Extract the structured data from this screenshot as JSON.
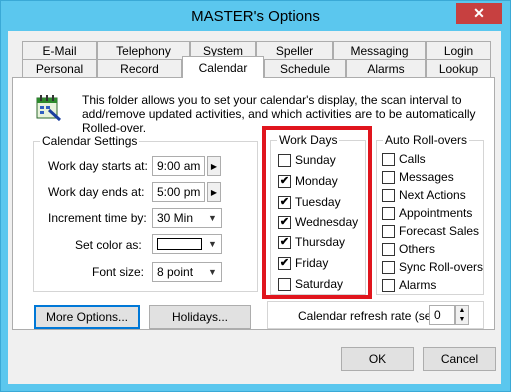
{
  "window": {
    "title": "MASTER's Options",
    "close_glyph": "✕"
  },
  "tabs_back": [
    "E-Mail",
    "Telephony",
    "System",
    "Speller",
    "Messaging",
    "Login"
  ],
  "tabs_front": [
    "Personal",
    "Record",
    "Calendar",
    "Schedule",
    "Alarms",
    "Lookup"
  ],
  "active_tab": "Calendar",
  "info": {
    "icon": "calendar-icon",
    "text": "This folder allows you to set your calendar's display, the scan interval to add/remove updated activities, and which activities are to be automatically Rolled-over."
  },
  "calendar_settings": {
    "title": "Calendar Settings",
    "work_start_label": "Work day starts at:",
    "work_start_value": "9:00 am",
    "work_end_label": "Work day ends at:",
    "work_end_value": "5:00 pm",
    "increment_label": "Increment time by:",
    "increment_value": "30 Min",
    "color_label": "Set color as:",
    "font_label": "Font size:",
    "font_value": "8 point"
  },
  "work_days": {
    "title": "Work Days",
    "days": [
      {
        "label": "Sunday",
        "checked": false
      },
      {
        "label": "Monday",
        "checked": true
      },
      {
        "label": "Tuesday",
        "checked": true
      },
      {
        "label": "Wednesday",
        "checked": true
      },
      {
        "label": "Thursday",
        "checked": true
      },
      {
        "label": "Friday",
        "checked": true
      },
      {
        "label": "Saturday",
        "checked": false
      }
    ],
    "highlight_color": "#e0151d"
  },
  "auto_rollovers": {
    "title": "Auto Roll-overs",
    "items": [
      {
        "label": "Calls",
        "checked": false
      },
      {
        "label": "Messages",
        "checked": false
      },
      {
        "label": "Next Actions",
        "checked": false
      },
      {
        "label": "Appointments",
        "checked": false
      },
      {
        "label": "Forecast Sales",
        "checked": false
      },
      {
        "label": "Others",
        "checked": false
      },
      {
        "label": "Sync Roll-overs",
        "checked": false
      },
      {
        "label": "Alarms",
        "checked": false
      }
    ]
  },
  "refresh": {
    "label": "Calendar refresh rate (sec):",
    "value": "0"
  },
  "buttons": {
    "more_options": "More Options...",
    "holidays": "Holidays...",
    "ok": "OK",
    "cancel": "Cancel"
  },
  "colors": {
    "titlebar": "#5bc7ee",
    "close": "#c74040",
    "focus": "#0078d7"
  }
}
